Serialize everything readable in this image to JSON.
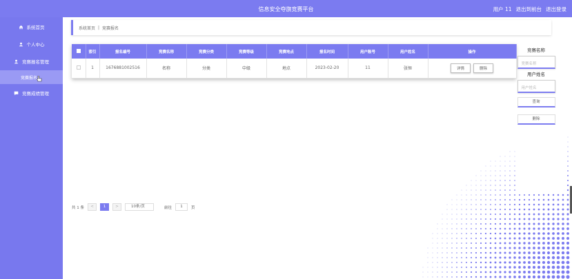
{
  "header": {
    "title": "信息安全夺旗竞赛平台",
    "user": "用户 11",
    "back_to_admin": "退出到前台",
    "logout": "退出登录"
  },
  "sidebar": {
    "items": [
      {
        "label": "系统首页",
        "icon": "home-icon"
      },
      {
        "label": "个人中心",
        "icon": "user-icon"
      },
      {
        "label": "竞赛报名管理",
        "icon": "person-icon"
      },
      {
        "label": "竞赛报名",
        "icon": ""
      },
      {
        "label": "竞赛成绩管理",
        "icon": "chat-icon"
      }
    ]
  },
  "breadcrumb": {
    "home": "系统首页",
    "sep": "|",
    "current": "竞赛报名"
  },
  "table": {
    "headers": [
      "",
      "索引",
      "报名编号",
      "竞赛名称",
      "竞赛分类",
      "竞赛等级",
      "竞赛地点",
      "报名时间",
      "用户账号",
      "用户姓名",
      "操作"
    ],
    "rows": [
      {
        "index": "1",
        "number": "1676881002516",
        "name": "名称",
        "category": "分类",
        "level": "中级",
        "place": "地点",
        "time": "2023-02-20",
        "account": "11",
        "username": "张恒",
        "detail": "详情",
        "delete": "删除"
      }
    ]
  },
  "search": {
    "label1": "竞赛名称",
    "placeholder1": "竞赛名称",
    "label2": "用户姓名",
    "placeholder2": "用户姓名",
    "query": "查询",
    "delete": "删除"
  },
  "pager": {
    "total": "共 1 条",
    "prev": "<",
    "current": "1",
    "next": ">",
    "size": "10条/页",
    "goto_label": "前往",
    "goto_value": "1",
    "page_unit": "页"
  },
  "colors": {
    "accent": "#7b7bf0",
    "sidebar": "#7878ee"
  }
}
